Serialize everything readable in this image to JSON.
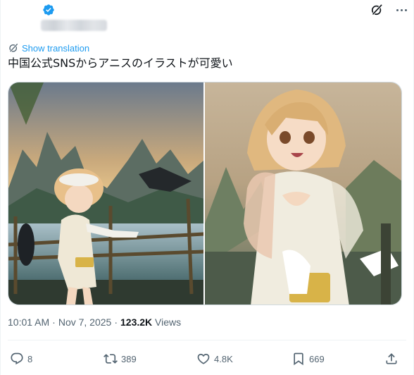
{
  "tweet": {
    "translate_label": "Show translation",
    "text": "中国公式SNSからアニスのイラストが可愛い",
    "time": "10:01 AM",
    "dot": "·",
    "date": "Nov 7, 2025",
    "views_count": "123.2K",
    "views_label": "Views"
  },
  "actions": {
    "replies": "8",
    "reposts": "389",
    "likes": "4.8K",
    "bookmarks": "669"
  },
  "colors": {
    "accent": "#1d9bf0",
    "secondary_text": "#536471",
    "primary_text": "#0f1419"
  }
}
